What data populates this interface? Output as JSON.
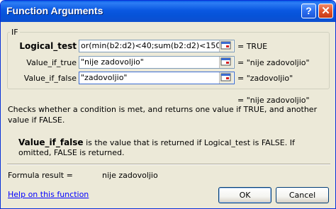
{
  "window": {
    "title": "Function Arguments",
    "help_symbol": "?",
    "close_symbol": "✕"
  },
  "function_group": {
    "name": "IF",
    "args": [
      {
        "label": "Logical_test",
        "value": "or(min(b2:d2)<40;sum(b2:d2)<150)",
        "result": "= TRUE"
      },
      {
        "label": "Value_if_true",
        "value": "\"nije zadovoljio\"",
        "result": "= \"nije zadovoljio\""
      },
      {
        "label": "Value_if_false",
        "value": "\"zadovoljio\"",
        "result": "= \"zadovoljio\""
      }
    ]
  },
  "overall_result": "= \"nije zadovoljio\"",
  "description": "Checks whether a condition is met, and returns one value if TRUE, and another value if FALSE.",
  "argument_help": {
    "name": "Value_if_false",
    "text": "is the value that is returned if Logical_test is FALSE. If omitted, FALSE is returned."
  },
  "formula_result": {
    "label": "Formula result =",
    "value": "nije zadovoljio"
  },
  "help_link": "Help on this function",
  "buttons": {
    "ok": "OK",
    "cancel": "Cancel"
  },
  "icons": [
    "help-icon",
    "close-icon",
    "collapse-dialog-icon"
  ],
  "colors": {
    "titlebar": "#0a58e1",
    "dialog_bg": "#ece9d8",
    "link": "#0000ff"
  }
}
